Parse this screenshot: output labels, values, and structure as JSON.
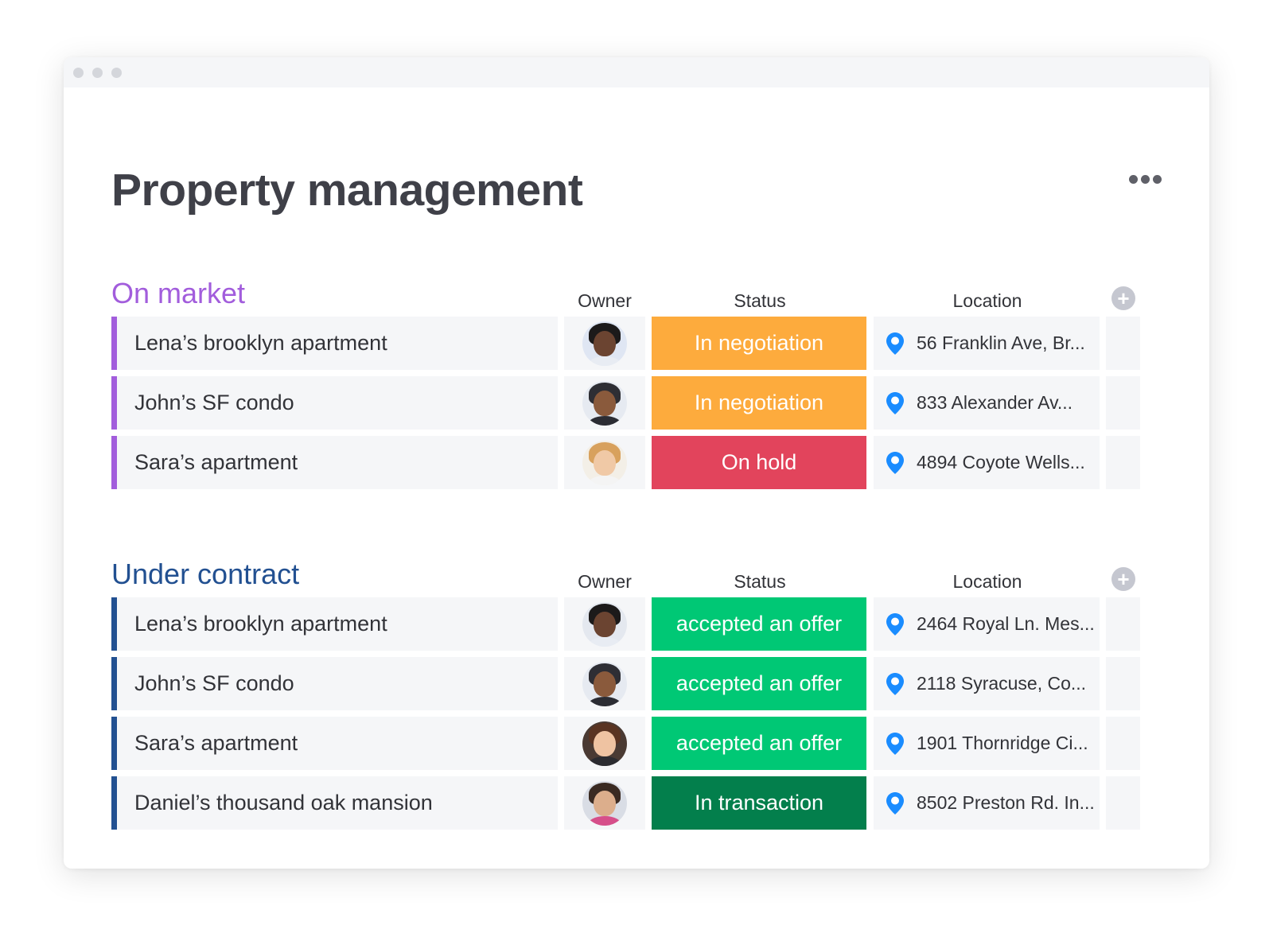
{
  "page": {
    "title": "Property management"
  },
  "colors": {
    "on_market": "#a25ddc",
    "under_contract": "#225091",
    "in_negotiation": "#fdab3d",
    "on_hold": "#e2445c",
    "accepted_offer": "#00c875",
    "in_transaction": "#037f4c",
    "pin": "#1a8cff"
  },
  "icons": {
    "more": "more-dots-icon",
    "add": "plus-circle-icon",
    "location": "map-pin-icon"
  },
  "groups": [
    {
      "title": "On market",
      "columns": {
        "owner": "Owner",
        "status": "Status",
        "location": "Location"
      },
      "rows": [
        {
          "name": "Lena’s brooklyn apartment",
          "status": "In negotiation",
          "location": "56 Franklin Ave, Br..."
        },
        {
          "name": "John’s SF condo",
          "status": "In negotiation",
          "location": "833  Alexander Av..."
        },
        {
          "name": "Sara’s apartment",
          "status": "On hold",
          "location": "4894 Coyote Wells..."
        }
      ]
    },
    {
      "title": "Under contract",
      "columns": {
        "owner": "Owner",
        "status": "Status",
        "location": "Location"
      },
      "rows": [
        {
          "name": "Lena’s brooklyn apartment",
          "status": "accepted an offer",
          "location": "2464 Royal Ln. Mes..."
        },
        {
          "name": "John’s SF condo",
          "status": "accepted an offer",
          "location": "2118 Syracuse, Co..."
        },
        {
          "name": "Sara’s apartment",
          "status": "accepted an offer",
          "location": "1901 Thornridge Ci..."
        },
        {
          "name": "Daniel’s thousand oak mansion",
          "status": "In transaction",
          "location": "8502 Preston Rd. In..."
        }
      ]
    }
  ]
}
